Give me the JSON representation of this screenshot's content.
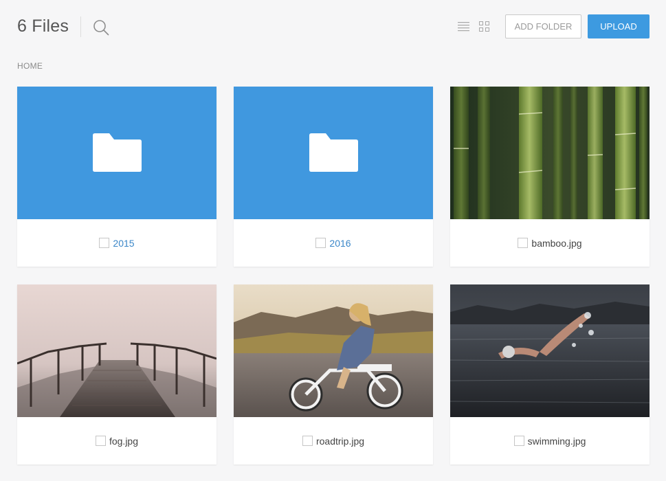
{
  "header": {
    "title": "6 Files",
    "search_icon": "search-icon",
    "list_view_icon": "list-view-icon",
    "grid_view_icon": "grid-view-icon",
    "add_folder_label": "ADD FOLDER",
    "upload_label": "UPLOAD"
  },
  "breadcrumb": {
    "label": "HOME"
  },
  "colors": {
    "accent": "#3d9ae0",
    "folder": "#4098df",
    "background": "#f6f6f7"
  },
  "files": [
    {
      "name": "2015",
      "kind": "folder",
      "icon": "folder-icon"
    },
    {
      "name": "2016",
      "kind": "folder",
      "icon": "folder-icon"
    },
    {
      "name": "bamboo.jpg",
      "kind": "image"
    },
    {
      "name": "fog.jpg",
      "kind": "image"
    },
    {
      "name": "roadtrip.jpg",
      "kind": "image"
    },
    {
      "name": "swimming.jpg",
      "kind": "image"
    }
  ]
}
